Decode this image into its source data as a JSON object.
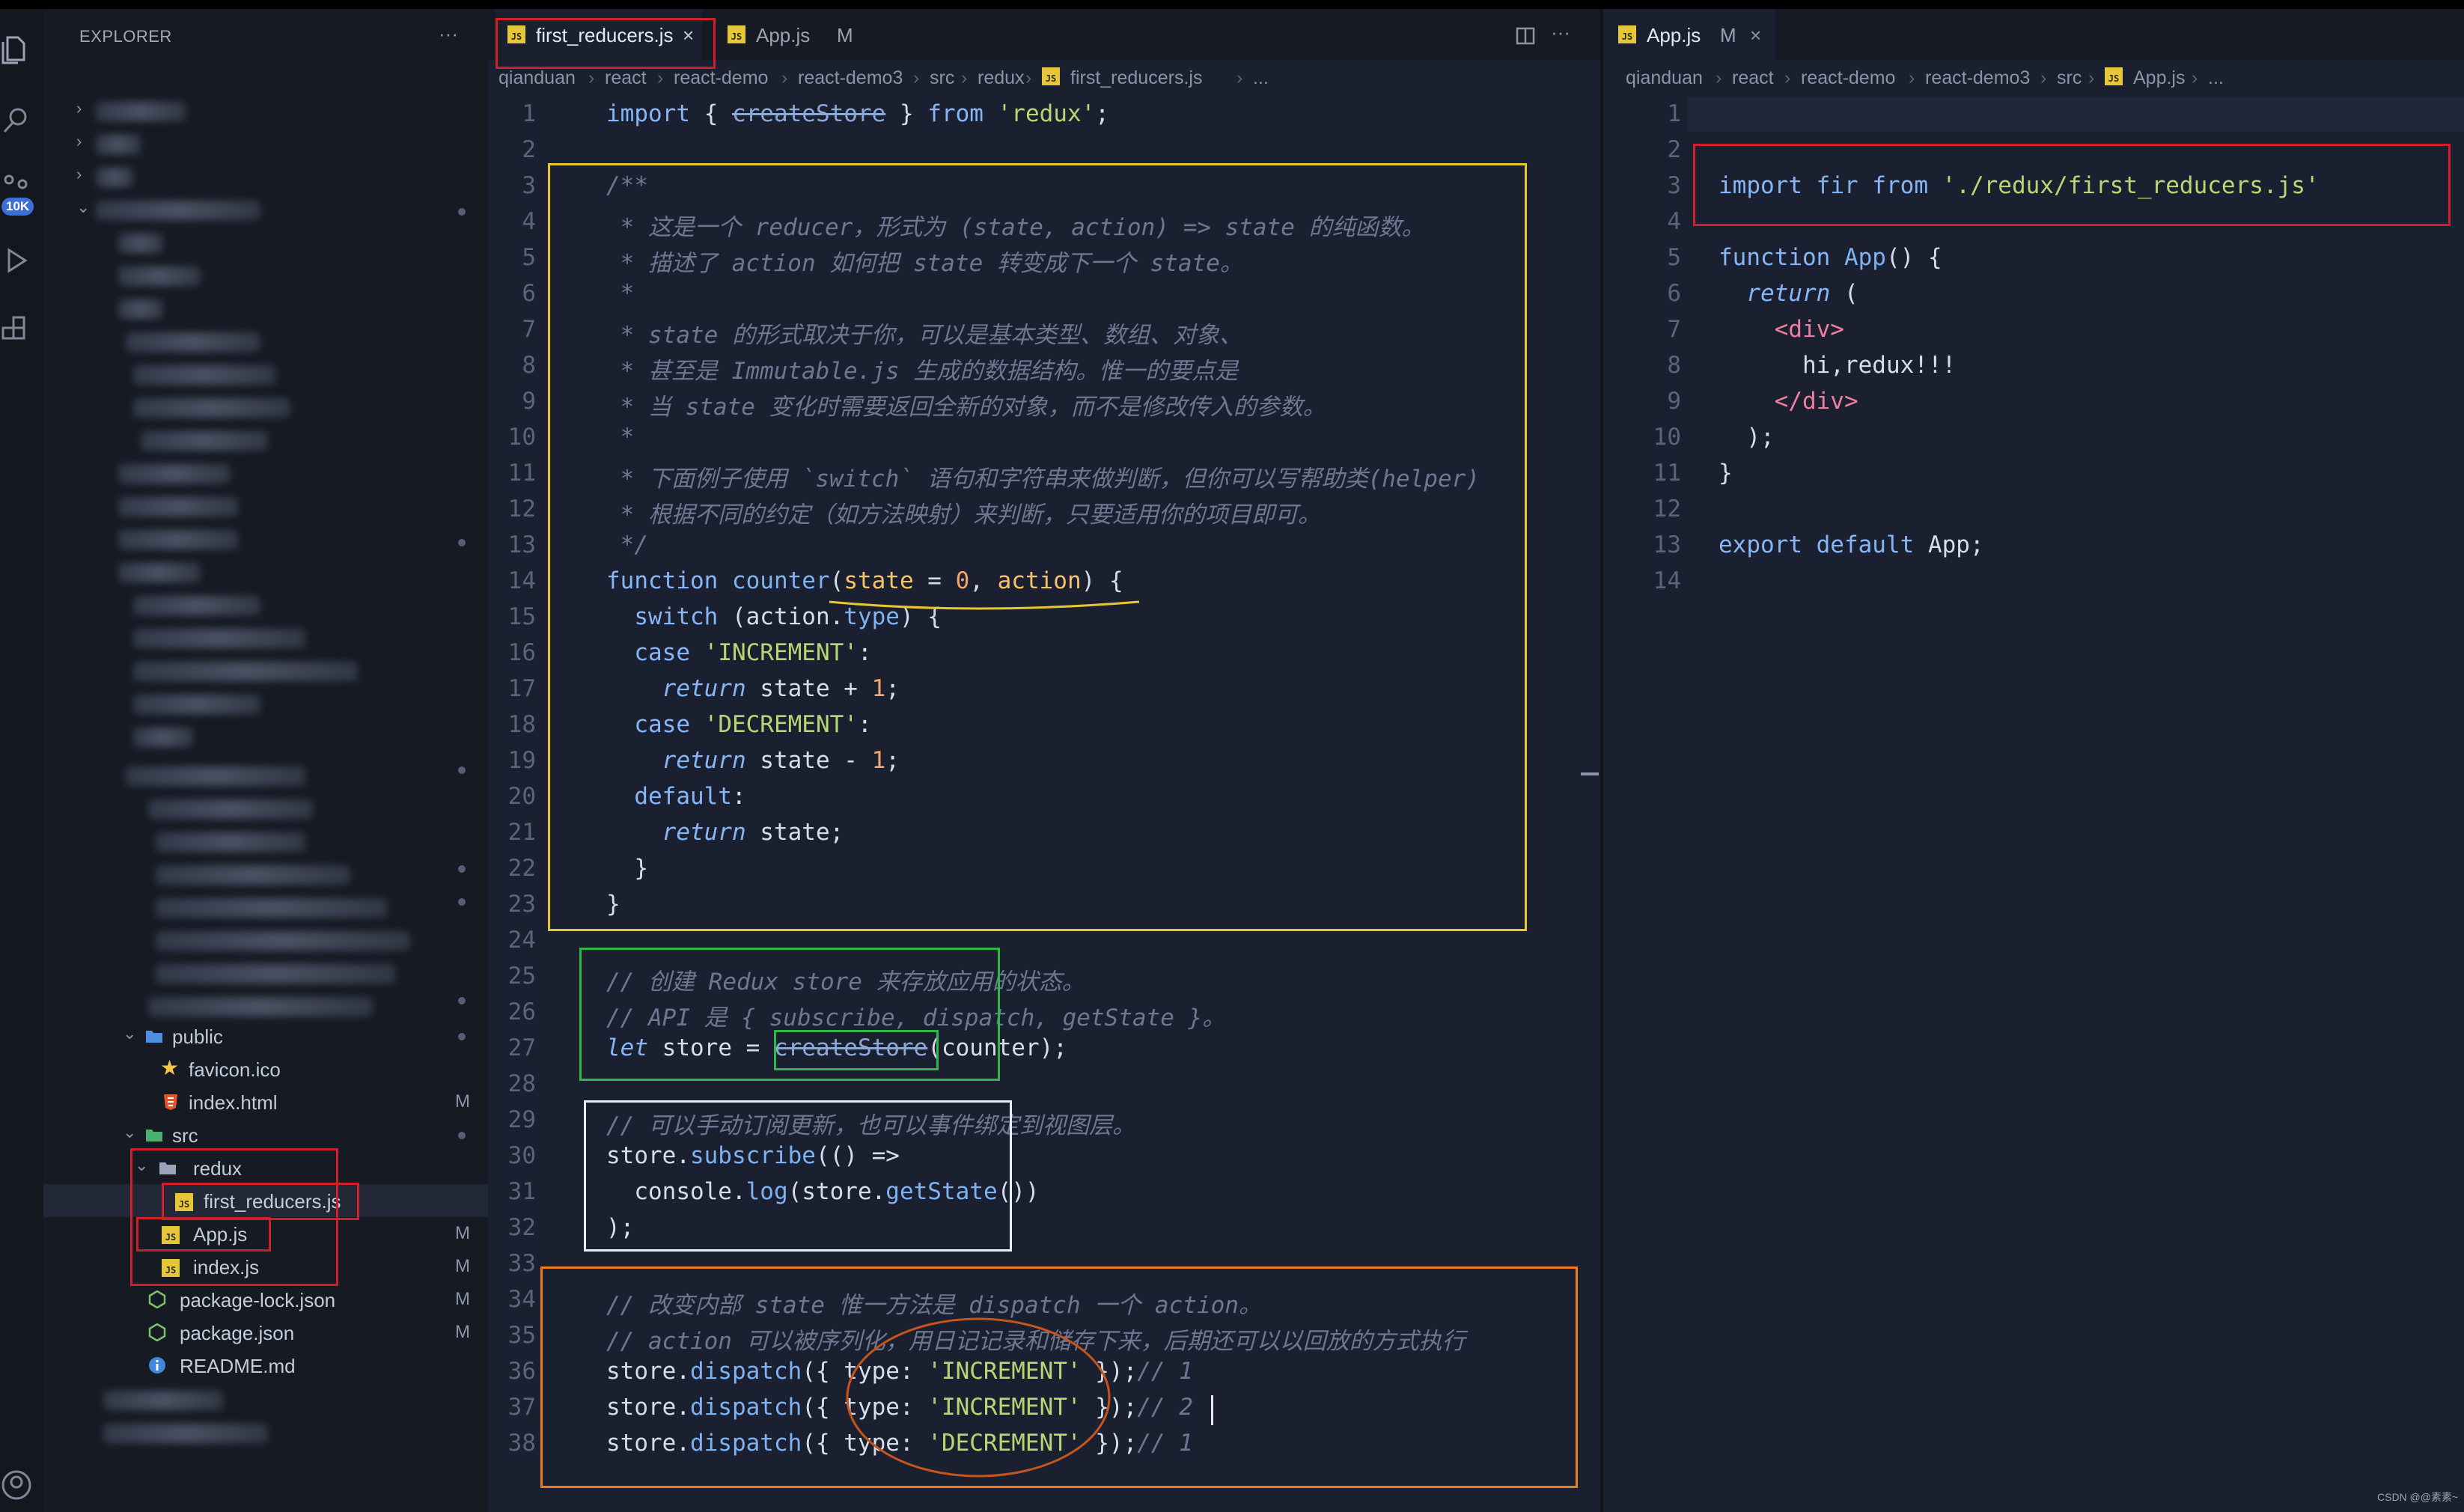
{
  "explorer": {
    "title": "EXPLORER",
    "more": "···",
    "badge": "10K",
    "items": [
      {
        "label": "public",
        "icon": "folder-icon",
        "indent": 1,
        "expanded": true,
        "status": "dot"
      },
      {
        "label": "favicon.ico",
        "icon": "star-icon",
        "indent": 2,
        "status": ""
      },
      {
        "label": "index.html",
        "icon": "html-icon",
        "indent": 2,
        "status": "M"
      },
      {
        "label": "src",
        "icon": "folder-icon",
        "indent": 1,
        "expanded": true,
        "status": "dot"
      },
      {
        "label": "redux",
        "icon": "folder-icon",
        "indent": 2,
        "expanded": true,
        "status": ""
      },
      {
        "label": "first_reducers.js",
        "icon": "js-file-icon",
        "indent": 3,
        "status": "",
        "selected": true
      },
      {
        "label": "App.js",
        "icon": "js-file-icon",
        "indent": 2,
        "status": "M"
      },
      {
        "label": "index.js",
        "icon": "js-file-icon",
        "indent": 2,
        "status": "M"
      },
      {
        "label": "package-lock.json",
        "icon": "json-icon",
        "indent": 1,
        "status": "M"
      },
      {
        "label": "package.json",
        "icon": "json-icon",
        "indent": 1,
        "status": "M"
      },
      {
        "label": "README.md",
        "icon": "info-icon",
        "indent": 1,
        "status": ""
      }
    ]
  },
  "left_editor": {
    "tabs": [
      {
        "label": "first_reducers.js",
        "active": true,
        "close": "×",
        "status": ""
      },
      {
        "label": "App.js",
        "active": false,
        "close": "",
        "status": "M"
      }
    ],
    "breadcrumbs": [
      "qianduan",
      "react",
      "react-demo",
      "react-demo3",
      "src",
      "redux",
      "first_reducers.js",
      "..."
    ],
    "lines": [
      {
        "n": "1",
        "html": "<span class='kw'>import</span> { <span class='strike'>createStore</span> } <span class='kw'>from</span> <span class='str'>'redux'</span>;"
      },
      {
        "n": "2",
        "html": ""
      },
      {
        "n": "3",
        "html": "<span class='cm'>/**</span>"
      },
      {
        "n": "4",
        "html": "<span class='cm'> * 这是一个 reducer，形式为 (state, action) => state 的纯函数。</span>"
      },
      {
        "n": "5",
        "html": "<span class='cm'> * 描述了 action 如何把 state 转变成下一个 state。</span>"
      },
      {
        "n": "6",
        "html": "<span class='cm'> *</span>"
      },
      {
        "n": "7",
        "html": "<span class='cm'> * state 的形式取决于你，可以是基本类型、数组、对象、</span>"
      },
      {
        "n": "8",
        "html": "<span class='cm'> * 甚至是 Immutable.js 生成的数据结构。惟一的要点是</span>"
      },
      {
        "n": "9",
        "html": "<span class='cm'> * 当 state 变化时需要返回全新的对象，而不是修改传入的参数。</span>"
      },
      {
        "n": "10",
        "html": "<span class='cm'> *</span>"
      },
      {
        "n": "11",
        "html": "<span class='cm'> * 下面例子使用 `switch` 语句和字符串来做判断，但你可以写帮助类(helper)</span>"
      },
      {
        "n": "12",
        "html": "<span class='cm'> * 根据不同的约定（如方法映射）来判断，只要适用你的项目即可。</span>"
      },
      {
        "n": "13",
        "html": "<span class='cm'> */</span>"
      },
      {
        "n": "14",
        "html": "<span class='kw'>function</span> <span class='fn'>counter</span>(<span class='param'>state</span> = <span class='num'>0</span>, <span class='param'>action</span>) {"
      },
      {
        "n": "15",
        "html": "  <span class='kw'>switch</span> (action.<span class='fn'>type</span>) {"
      },
      {
        "n": "16",
        "html": "  <span class='kw'>case</span> <span class='str'>'INCREMENT'</span>:"
      },
      {
        "n": "17",
        "html": "    <span class='ital'>return</span> state + <span class='num'>1</span>;"
      },
      {
        "n": "18",
        "html": "  <span class='kw'>case</span> <span class='str'>'DECREMENT'</span>:"
      },
      {
        "n": "19",
        "html": "    <span class='ital'>return</span> state - <span class='num'>1</span>;"
      },
      {
        "n": "20",
        "html": "  <span class='kw'>default</span>:"
      },
      {
        "n": "21",
        "html": "    <span class='ital'>return</span> state;"
      },
      {
        "n": "22",
        "html": "  }"
      },
      {
        "n": "23",
        "html": "}"
      },
      {
        "n": "24",
        "html": ""
      },
      {
        "n": "25",
        "html": "<span class='cm'>// 创建 Redux store 来存放应用的状态。</span>"
      },
      {
        "n": "26",
        "html": "<span class='cm'>// API 是 { subscribe, dispatch, getState }。</span>"
      },
      {
        "n": "27",
        "html": "<span class='ital'>let</span> store = <span class='strike'>createStore</span>(counter);"
      },
      {
        "n": "28",
        "html": ""
      },
      {
        "n": "29",
        "html": "<span class='cm'>// 可以手动订阅更新，也可以事件绑定到视图层。</span>"
      },
      {
        "n": "30",
        "html": "store.<span class='fn'>subscribe</span>(() =>"
      },
      {
        "n": "31",
        "html": "  console.<span class='fn'>log</span>(store.<span class='fn'>getState</span>())"
      },
      {
        "n": "32",
        "html": ");"
      },
      {
        "n": "33",
        "html": ""
      },
      {
        "n": "34",
        "html": "<span class='cm'>// 改变内部 state 惟一方法是 dispatch 一个 action。</span>"
      },
      {
        "n": "35",
        "html": "<span class='cm'>// action 可以被序列化，用日记记录和储存下来，后期还可以以回放的方式执行</span>"
      },
      {
        "n": "36",
        "html": "store.<span class='fn'>dispatch</span>({ type: <span class='str'>'INCREMENT'</span> });<span class='cm'>// 1</span>"
      },
      {
        "n": "37",
        "html": "store.<span class='fn'>dispatch</span>({ type: <span class='str'>'INCREMENT'</span> });<span class='cm'>// 2</span>"
      },
      {
        "n": "38",
        "html": "store.<span class='fn'>dispatch</span>({ type: <span class='str'>'DECREMENT'</span> });<span class='cm'>// 1</span>"
      }
    ]
  },
  "right_editor": {
    "tabs": [
      {
        "label": "App.js",
        "active": true,
        "close": "×",
        "status": "M"
      }
    ],
    "breadcrumbs": [
      "qianduan",
      "react",
      "react-demo",
      "react-demo3",
      "src",
      "App.js",
      "..."
    ],
    "lines": [
      {
        "n": "1",
        "html": ""
      },
      {
        "n": "2",
        "html": ""
      },
      {
        "n": "3",
        "html": "<span class='kw'>import</span> <span class='fn'>fir</span> <span class='kw'>from</span> <span class='str'>'./redux/first_reducers.js'</span>"
      },
      {
        "n": "4",
        "html": ""
      },
      {
        "n": "5",
        "html": "<span class='kw'>function</span> <span class='fn'>App</span>() {"
      },
      {
        "n": "6",
        "html": "  <span class='ital'>return</span> ("
      },
      {
        "n": "7",
        "html": "    <span class='tag'>&lt;div&gt;</span>"
      },
      {
        "n": "8",
        "html": "      hi,redux!!!"
      },
      {
        "n": "9",
        "html": "    <span class='tag'>&lt;/div&gt;</span>"
      },
      {
        "n": "10",
        "html": "  );"
      },
      {
        "n": "11",
        "html": "}"
      },
      {
        "n": "12",
        "html": ""
      },
      {
        "n": "13",
        "html": "<span class='kw'>export default</span> App;"
      },
      {
        "n": "14",
        "html": ""
      }
    ]
  },
  "watermark": "CSDN @@素素~"
}
